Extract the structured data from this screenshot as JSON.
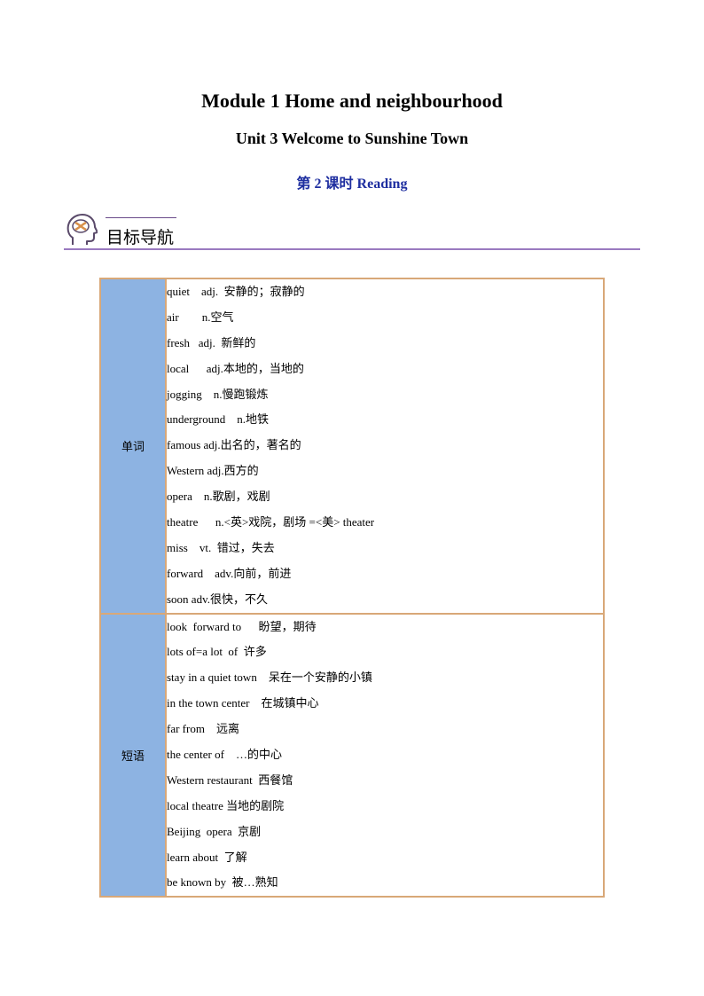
{
  "header": {
    "module_title": "Module 1 Home and neighbourhood",
    "unit_title": "Unit 3 Welcome to Sunshine  Town",
    "lesson_title": "第 2 课时 Reading"
  },
  "section": {
    "icon": "brain-head-icon",
    "title": "目标导航"
  },
  "table": {
    "sections": [
      {
        "category": "单词",
        "items": [
          "quiet    adj.  安静的；寂静的",
          "air        n.空气",
          "fresh   adj.  新鲜的",
          "local      adj.本地的，当地的",
          "jogging    n.慢跑锻炼",
          "underground    n.地铁",
          "famous adj.出名的，著名的",
          "Western adj.西方的",
          "opera    n.歌剧，戏剧",
          "theatre      n.<英>戏院，剧场 =<美> theater",
          "miss    vt.  错过，失去",
          "forward    adv.向前，前进",
          "soon adv.很快，不久"
        ]
      },
      {
        "category": "短语",
        "items": [
          "look  forward to      盼望，期待",
          "lots of=a lot  of  许多",
          "stay in a quiet town    呆在一个安静的小镇",
          "in the town center    在城镇中心",
          "far from    远离",
          "the center of    …的中心",
          "Western restaurant  西餐馆",
          "local theatre 当地的剧院",
          "Beijing  opera  京剧",
          "learn about  了解",
          "be known by  被…熟知"
        ]
      }
    ]
  }
}
